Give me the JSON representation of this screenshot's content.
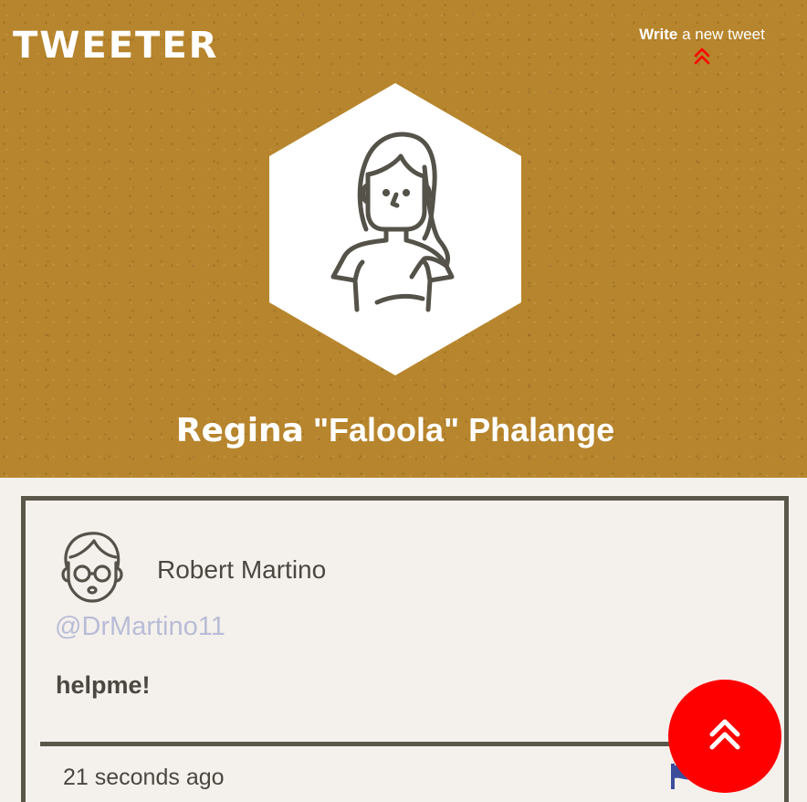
{
  "header": {
    "brand": "TWEETER",
    "write_link": {
      "bold": "Write",
      "rest": " a new tweet"
    },
    "chevron_icon": "double-chevron-up-icon",
    "chevron_color": "#ff0000",
    "background_color": "#b7852d"
  },
  "profile": {
    "name_first": "Regina",
    "name_rest": " \"Faloola\" Phalange",
    "avatar_icon": "woman-avatar-icon"
  },
  "tweet": {
    "author_name": "Robert Martino",
    "handle": "@DrMartino11",
    "text": "helpme!",
    "time": "21 seconds ago",
    "avatar_icon": "man-with-glasses-avatar-icon",
    "flag_icon": "flag-icon"
  },
  "scroll_top_button": {
    "icon": "double-chevron-up-icon",
    "color": "#ff0000"
  }
}
